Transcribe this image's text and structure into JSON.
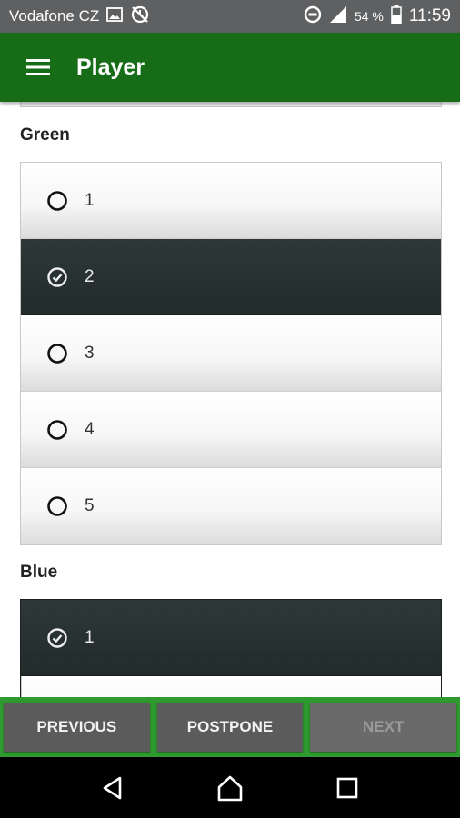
{
  "status_bar": {
    "carrier": "Vodafone CZ",
    "battery_percent": "54 %",
    "time": "11:59",
    "icons": [
      "image-icon",
      "sync-disabled-icon",
      "do-not-disturb-icon",
      "signal-icon",
      "battery-icon"
    ]
  },
  "app_bar": {
    "title": "Player",
    "menu_icon": "hamburger-menu-icon"
  },
  "colors": {
    "app_bar": "#176d17",
    "status_bar": "#5f6062",
    "button_bar": "#2f9a2f",
    "button": "#5b5b5b",
    "selected_option": "#263030"
  },
  "sections": [
    {
      "label": "Green",
      "options": [
        {
          "label": "1",
          "selected": false
        },
        {
          "label": "2",
          "selected": true
        },
        {
          "label": "3",
          "selected": false
        },
        {
          "label": "4",
          "selected": false
        },
        {
          "label": "5",
          "selected": false
        }
      ]
    },
    {
      "label": "Blue",
      "options": [
        {
          "label": "1",
          "selected": true
        },
        {
          "label": "",
          "selected": false
        }
      ]
    }
  ],
  "buttons": {
    "previous": "PREVIOUS",
    "postpone": "POSTPONE",
    "next": "NEXT",
    "next_enabled": false
  },
  "nav_bar": {
    "icons": [
      "back-icon",
      "home-icon",
      "recents-icon"
    ]
  }
}
